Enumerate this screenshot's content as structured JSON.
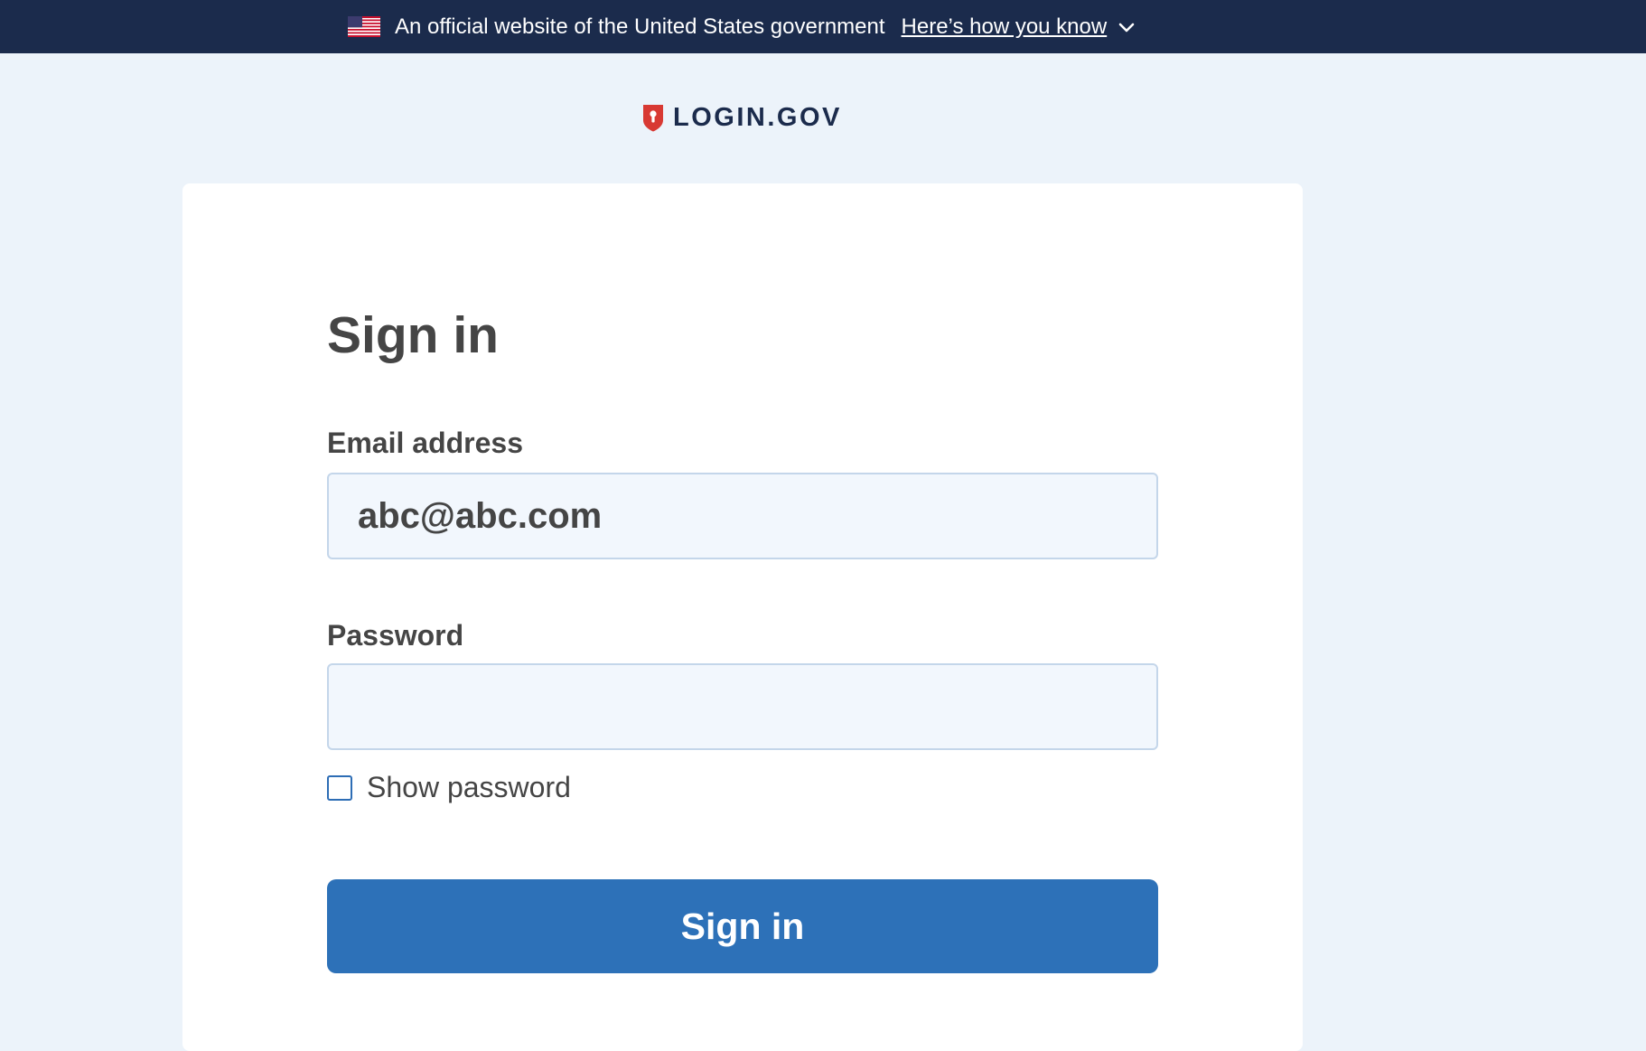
{
  "gov_banner": {
    "text": "An official website of the United States government",
    "link_label": "Here’s how you know",
    "flag_icon": "us-flag-icon",
    "chevron_icon": "chevron-down-icon",
    "background_color": "#1b2b4c"
  },
  "brand": {
    "logo_icon": "shield-icon",
    "name": "LOGIN.GOV",
    "accent_color": "#d83933"
  },
  "sign_in_form": {
    "title": "Sign in",
    "email_label": "Email address",
    "email_value": "abc@abc.com",
    "password_label": "Password",
    "password_value": "",
    "show_password_label": "Show password",
    "show_password_checked": false,
    "submit_label": "Sign in",
    "button_color": "#2d71b8"
  }
}
